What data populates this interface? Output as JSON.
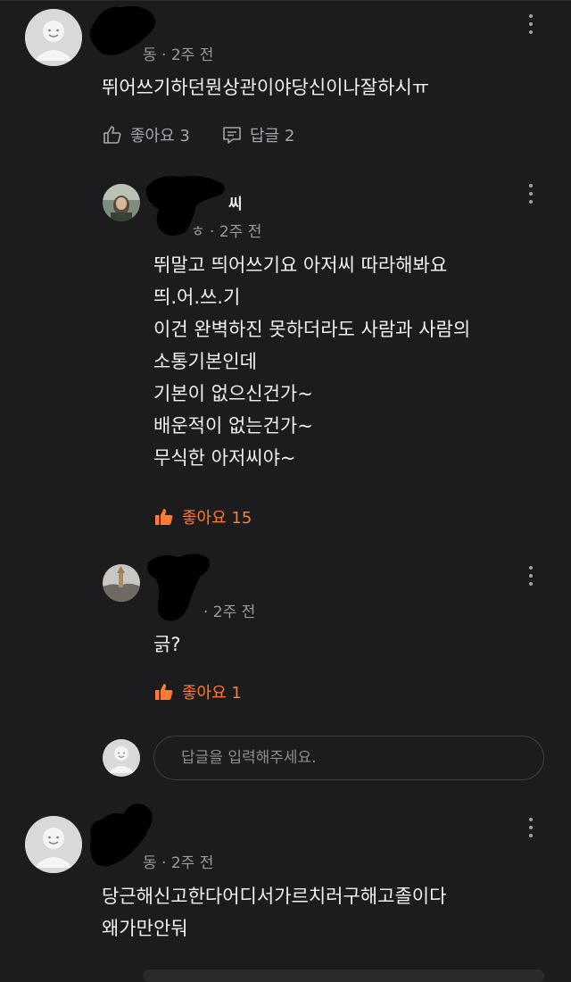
{
  "comments": [
    {
      "name_tail": "",
      "meta": "동 · 2주 전",
      "text": "뛰어쓰기하던뭔상관이야당신이나잘하시ㅠ",
      "like_label": "좋아요 3",
      "reply_label": "답글 2"
    },
    {
      "name_tail": "씨",
      "meta": "ㅎ · 2주 전",
      "text": "뛰말고 띄어쓰기요 아저씨 따라해봐요\n띄.어.쓰.기\n이건 완벽하진 못하더라도 사람과 사람의\n소통기본인데\n기본이 없으신건가~\n배운적이 없는건가~\n무식한 아저씨야~",
      "like_label": "좋아요 15"
    },
    {
      "name_tail": "",
      "meta": " · 2주 전",
      "text": "긁?",
      "like_label": "좋아요 1"
    },
    {
      "name_tail": "",
      "meta": "동 · 2주 전",
      "text": "당근해신고한다어디서가르치러구해고졸이다\n왜가만안둬"
    }
  ],
  "reply_input": {
    "placeholder": "답글을 입력해주세요."
  },
  "icons": {
    "like": "thumbs-up-icon",
    "reply": "comment-icon",
    "more": "more-vertical-icon"
  },
  "colors": {
    "background": "#1c1c1e",
    "accent": "#ff7a33",
    "muted": "#9a9a9f"
  }
}
